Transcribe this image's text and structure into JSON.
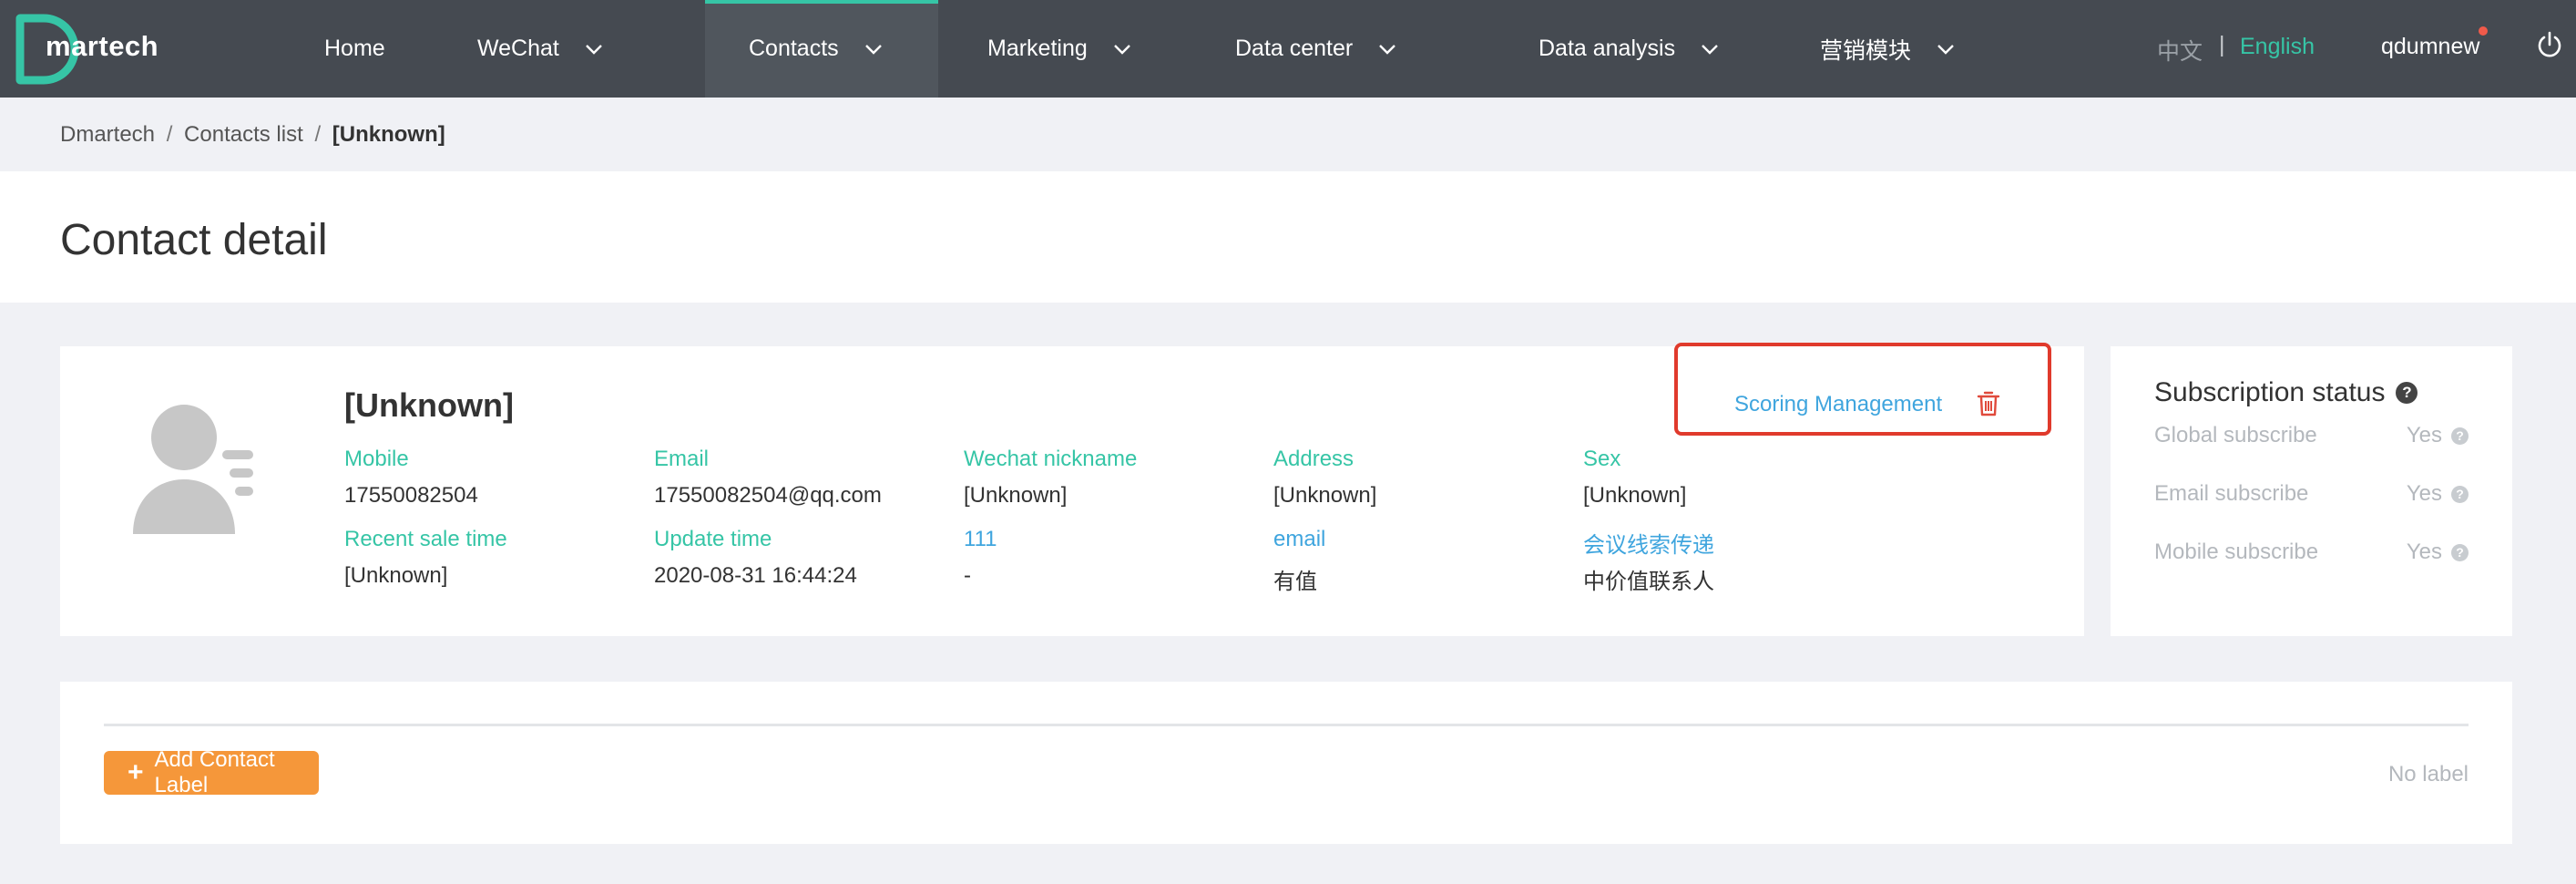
{
  "nav": {
    "logo_text": "martech",
    "items": [
      {
        "label": "Home",
        "has_dropdown": false
      },
      {
        "label": "WeChat",
        "has_dropdown": true
      },
      {
        "label": "Contacts",
        "has_dropdown": true,
        "active": true
      },
      {
        "label": "Marketing",
        "has_dropdown": true
      },
      {
        "label": "Data center",
        "has_dropdown": true
      },
      {
        "label": "Data analysis",
        "has_dropdown": true
      },
      {
        "label": "营销模块",
        "has_dropdown": true
      }
    ],
    "lang_zh": "中文",
    "lang_separator": "|",
    "lang_en": "English",
    "username": "qdumnew",
    "icons": {
      "logout": "power-icon",
      "dropdown": "chevron-down-icon"
    }
  },
  "breadcrumb": {
    "root": "Dmartech",
    "parent": "Contacts list",
    "current": "[Unknown]",
    "separator": "/"
  },
  "page": {
    "title": "Contact detail"
  },
  "contact": {
    "name": "[Unknown]",
    "scoring_link": "Scoring Management",
    "fields_row1": [
      {
        "label": "Mobile",
        "value": "17550082504"
      },
      {
        "label": "Email",
        "value": "17550082504@qq.com"
      },
      {
        "label": "Wechat nickname",
        "value": "[Unknown]"
      },
      {
        "label": "Address",
        "value": "[Unknown]"
      },
      {
        "label": "Sex",
        "value": "[Unknown]"
      }
    ],
    "fields_row2": [
      {
        "label": "Recent sale time",
        "value": "[Unknown]"
      },
      {
        "label": "Update time",
        "value": "2020-08-31 16:44:24"
      },
      {
        "label": "111",
        "value": "-"
      },
      {
        "label": "email",
        "value": "有值"
      },
      {
        "label": "会议线索传递",
        "value": "中价值联系人"
      }
    ]
  },
  "subscription": {
    "title": "Subscription status",
    "items": [
      {
        "label": "Global subscribe",
        "value": "Yes"
      },
      {
        "label": "Email subscribe",
        "value": "Yes"
      },
      {
        "label": "Mobile subscribe",
        "value": "Yes"
      }
    ]
  },
  "labels": {
    "add_button": "Add Contact Label",
    "empty_text": "No label"
  },
  "colors": {
    "nav_bg": "#454a51",
    "accent_teal": "#36c5a6",
    "link_blue": "#3fa5de",
    "orange_button": "#f5973a",
    "highlight_red": "#e03a2c",
    "trash_red": "#e04a3c"
  }
}
